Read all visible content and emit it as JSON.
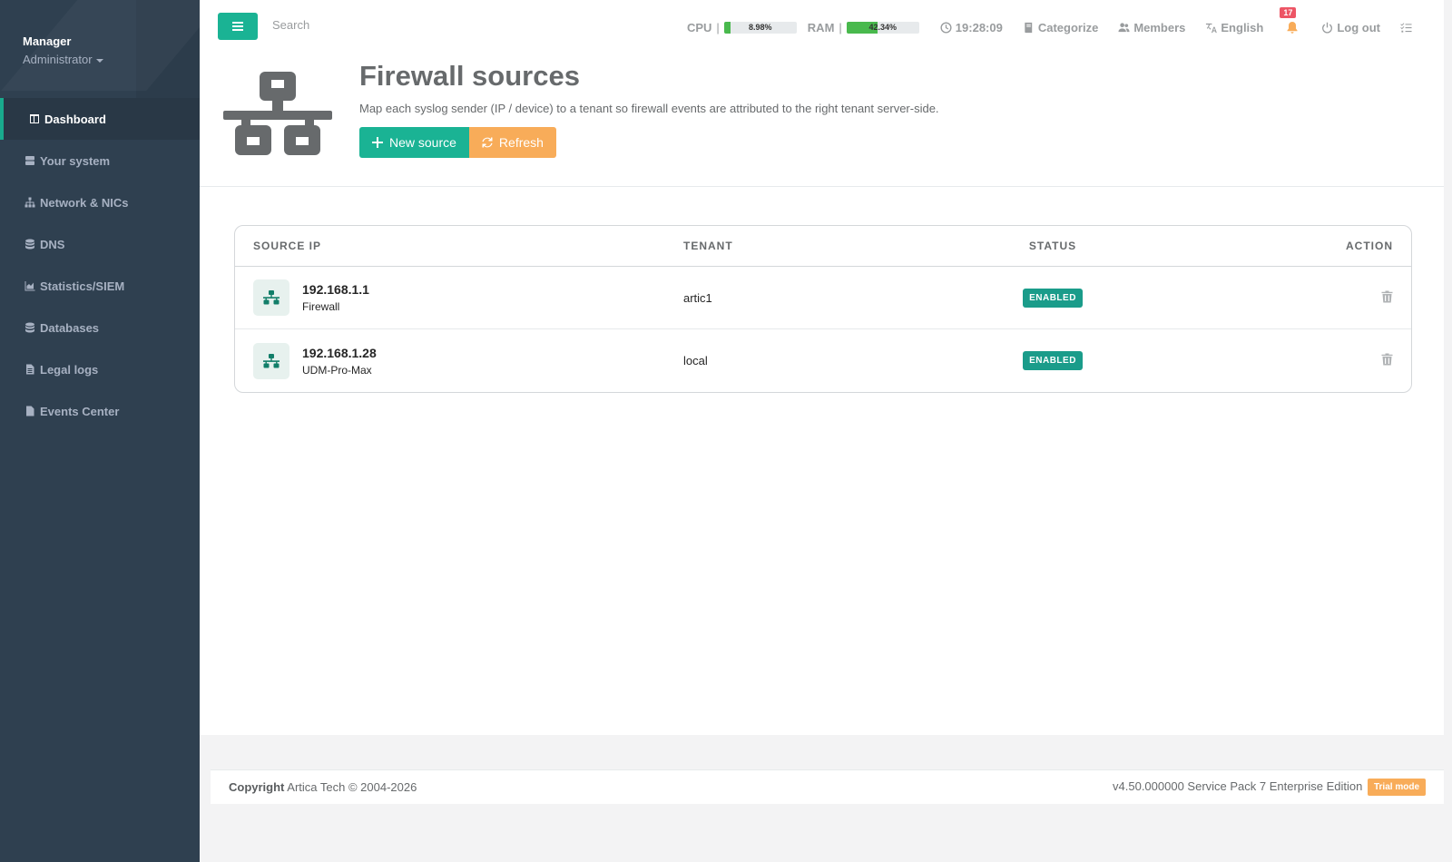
{
  "sidebar": {
    "user_name": "Manager",
    "user_role": "Administrator",
    "items": [
      {
        "label": "Dashboard",
        "icon": "table-icon",
        "active": true
      },
      {
        "label": "Your system",
        "icon": "server-icon"
      },
      {
        "label": "Network & NICs",
        "icon": "sitemap-icon"
      },
      {
        "label": "DNS",
        "icon": "database-icon"
      },
      {
        "label": "Statistics/SIEM",
        "icon": "area-chart-icon"
      },
      {
        "label": "Databases",
        "icon": "database-icon"
      },
      {
        "label": "Legal logs",
        "icon": "file-icon"
      },
      {
        "label": "Events Center",
        "icon": "file-text-icon"
      }
    ]
  },
  "topbar": {
    "search_placeholder": "Search",
    "cpu_label": "CPU",
    "cpu_value": "8.98%",
    "cpu_fraction": 0.0898,
    "ram_label": "RAM",
    "ram_value": "42.34%",
    "ram_fraction": 0.4234,
    "time": "19:28:09",
    "categorize": "Categorize",
    "members": "Members",
    "language": "English",
    "notifications_count": "17",
    "logout": "Log out",
    "separator": "|"
  },
  "page": {
    "title": "Firewall sources",
    "description": "Map each syslog sender (IP / device) to a tenant so firewall events are attributed to the right tenant server-side.",
    "new_source_label": "New source",
    "refresh_label": "Refresh"
  },
  "table": {
    "headers": {
      "source_ip": "SOURCE IP",
      "tenant": "TENANT",
      "status": "STATUS",
      "action": "ACTION"
    },
    "rows": [
      {
        "ip": "192.168.1.1",
        "device": "Firewall",
        "tenant": "artic1",
        "status": "ENABLED"
      },
      {
        "ip": "192.168.1.28",
        "device": "UDM-Pro-Max",
        "tenant": "local",
        "status": "ENABLED"
      }
    ]
  },
  "footer": {
    "copyright_label": "Copyright",
    "copyright_text": "Artica Tech © 2004-2026",
    "version": "v4.50.000000 Service Pack 7 Enterprise Edition",
    "trial": "Trial mode"
  },
  "colors": {
    "primary": "#1ab394",
    "warning": "#f8ac59",
    "sidebar": "#2f4050",
    "badge": "#1a9c8a",
    "danger": "#ed5565"
  }
}
